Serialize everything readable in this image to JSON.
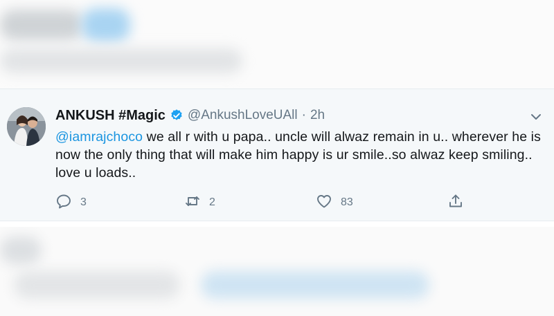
{
  "tweet": {
    "author_name": "ANKUSH #Magic",
    "handle": "@AnkushLoveUAll",
    "separator": "·",
    "time": "2h",
    "mention": "@iamrajchoco",
    "text": " we all r with u papa.. uncle will alwaz remain in u.. wherever he is now the only thing that will make him happy is ur smile..so alwaz keep smiling..  love u loads..",
    "replies": "3",
    "retweets": "2",
    "likes": "83"
  },
  "icons": {
    "verified": "verified-badge-icon",
    "menu": "chevron-down-icon",
    "reply": "reply-icon",
    "retweet": "retweet-icon",
    "like": "heart-icon",
    "share": "share-icon"
  },
  "colors": {
    "accent": "#1da1f2",
    "mention": "#1b95e0",
    "muted": "#657786",
    "card_bg": "#f5f8fa"
  }
}
